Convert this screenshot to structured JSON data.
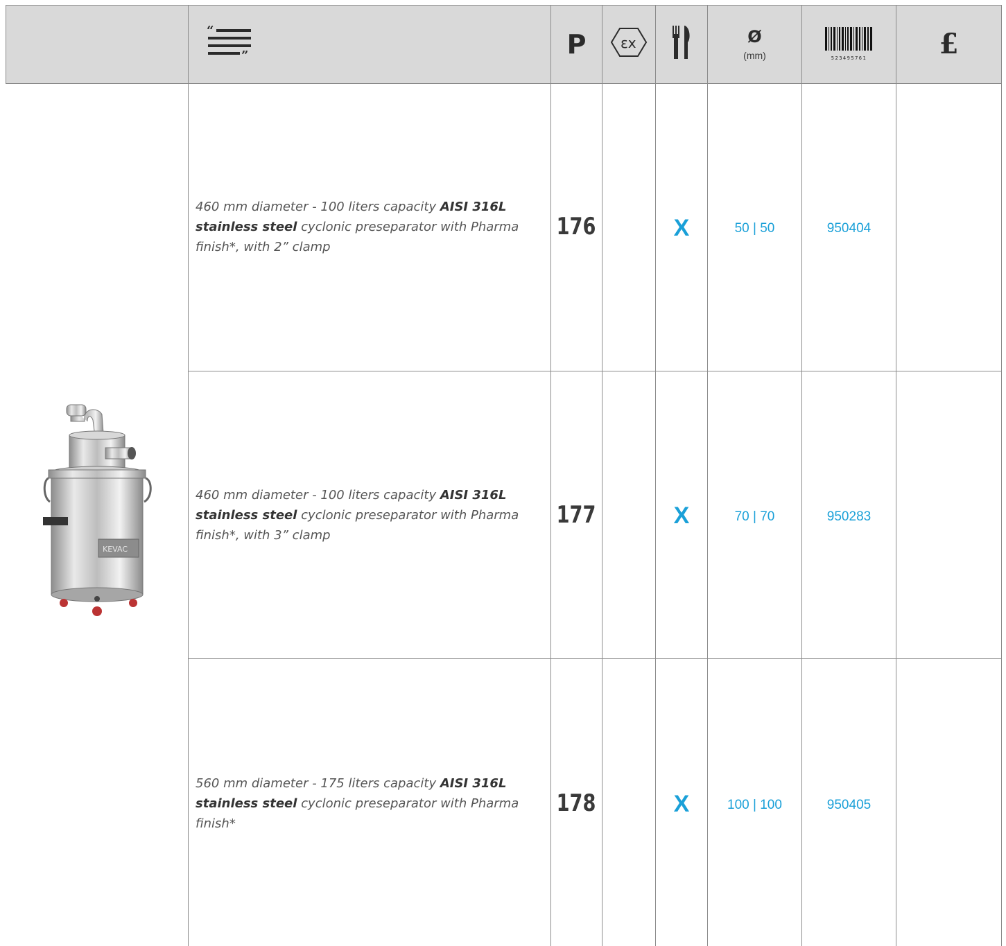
{
  "header": {
    "col_p": "P",
    "col_diameter_symbol": "Ø",
    "col_diameter_unit": "(mm)",
    "col_barcode_number": "523495761",
    "col_price": "£",
    "icons": [
      "description-icon",
      "atex-ex-icon",
      "food-cutlery-icon",
      "barcode-icon"
    ]
  },
  "product_image": {
    "brand_text": "KEVAC"
  },
  "rows": [
    {
      "desc_pre": "460 mm diameter - 100 liters capacity ",
      "desc_bold": "AISI 316L stainless steel",
      "desc_post": " cyclonic preseparator with Pharma finish*, with 2” clamp",
      "p": "176",
      "food": "X",
      "diameter": "50 | 50",
      "code": "950404"
    },
    {
      "desc_pre": "460 mm diameter - 100 liters capacity ",
      "desc_bold": "AISI 316L stainless steel",
      "desc_post": " cyclonic preseparator with Pharma finish*, with 3” clamp",
      "p": "177",
      "food": "X",
      "diameter": "70 | 70",
      "code": "950283"
    },
    {
      "desc_pre": "560 mm diameter - 175 liters capacity ",
      "desc_bold": "AISI 316L stainless steel",
      "desc_post": " cyclonic preseparator with Pharma finish*",
      "p": "178",
      "food": "X",
      "diameter": "100 | 100",
      "code": "950405"
    }
  ],
  "colors": {
    "accent": "#1aa0d8",
    "header_bg": "#d9d9d9",
    "grid": "#8a8a8a"
  }
}
